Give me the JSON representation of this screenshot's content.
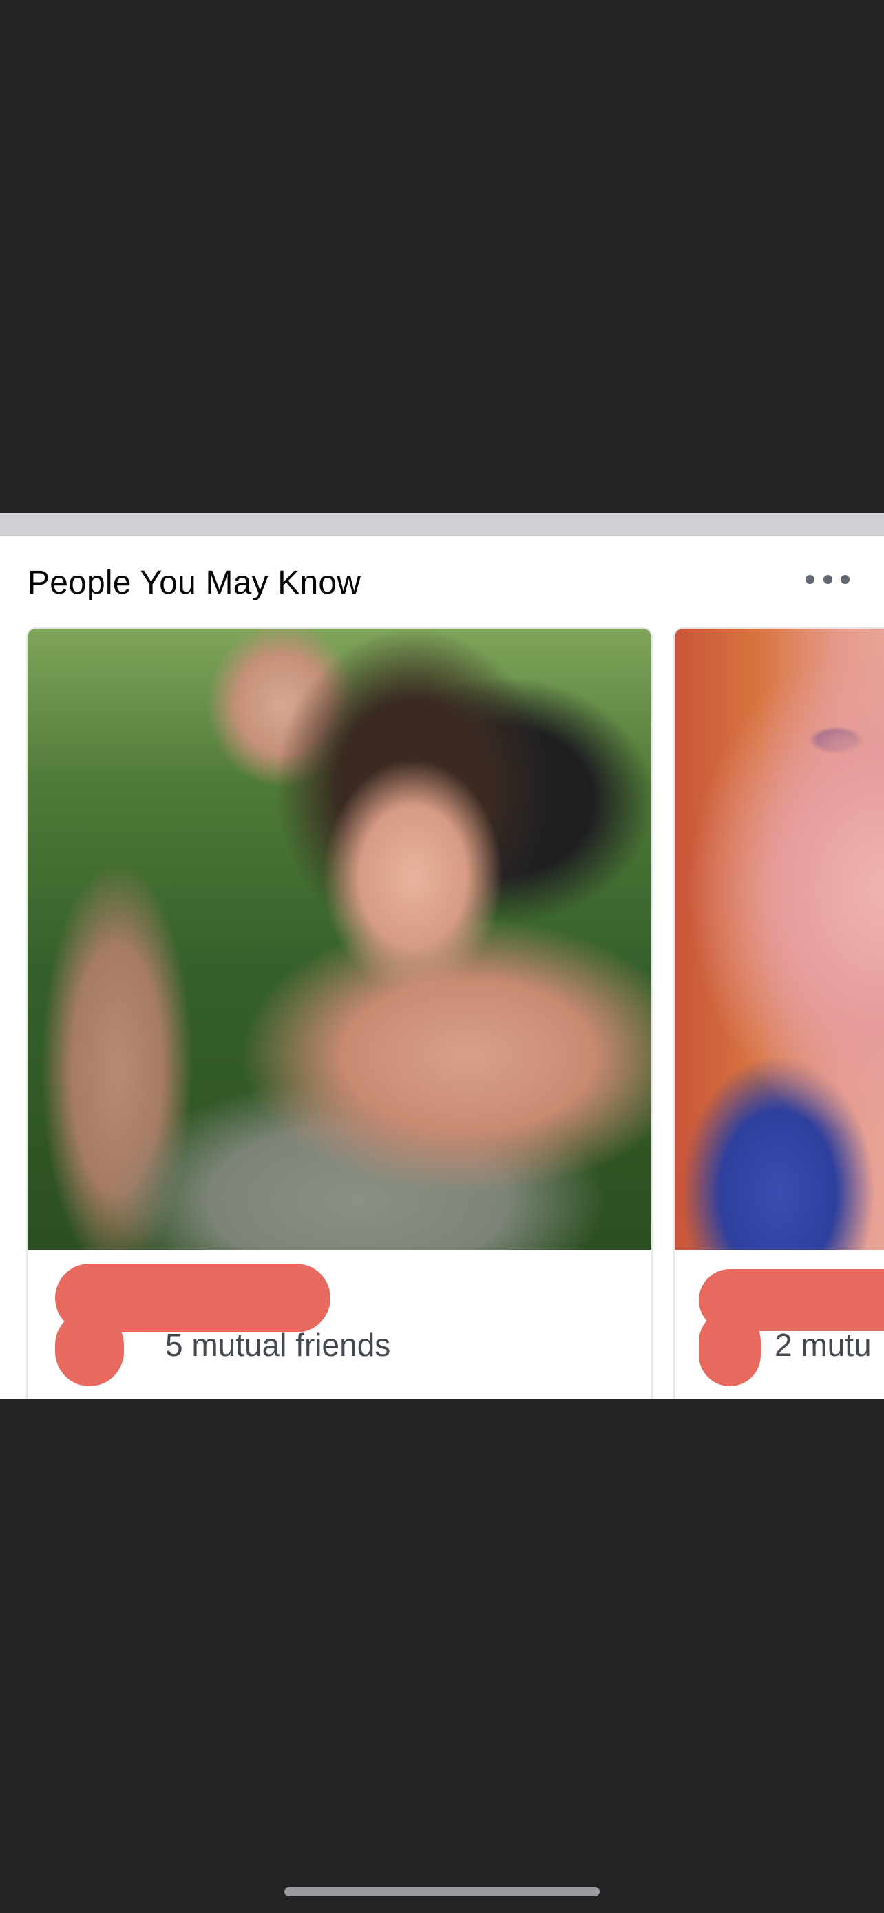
{
  "section": {
    "title": "People You May Know",
    "more_icon": "more-horizontal-icon"
  },
  "suggestions": [
    {
      "name": "",
      "name_redacted": true,
      "mutual_friends": "5 mutual friends"
    },
    {
      "name": "",
      "name_redacted": true,
      "mutual_friends": "2 mutu"
    }
  ],
  "colors": {
    "background_dark": "#232325",
    "divider": "#cfd0d4",
    "card_bg": "#ffffff",
    "redaction": "#e86a5e",
    "secondary_text": "#444950"
  }
}
